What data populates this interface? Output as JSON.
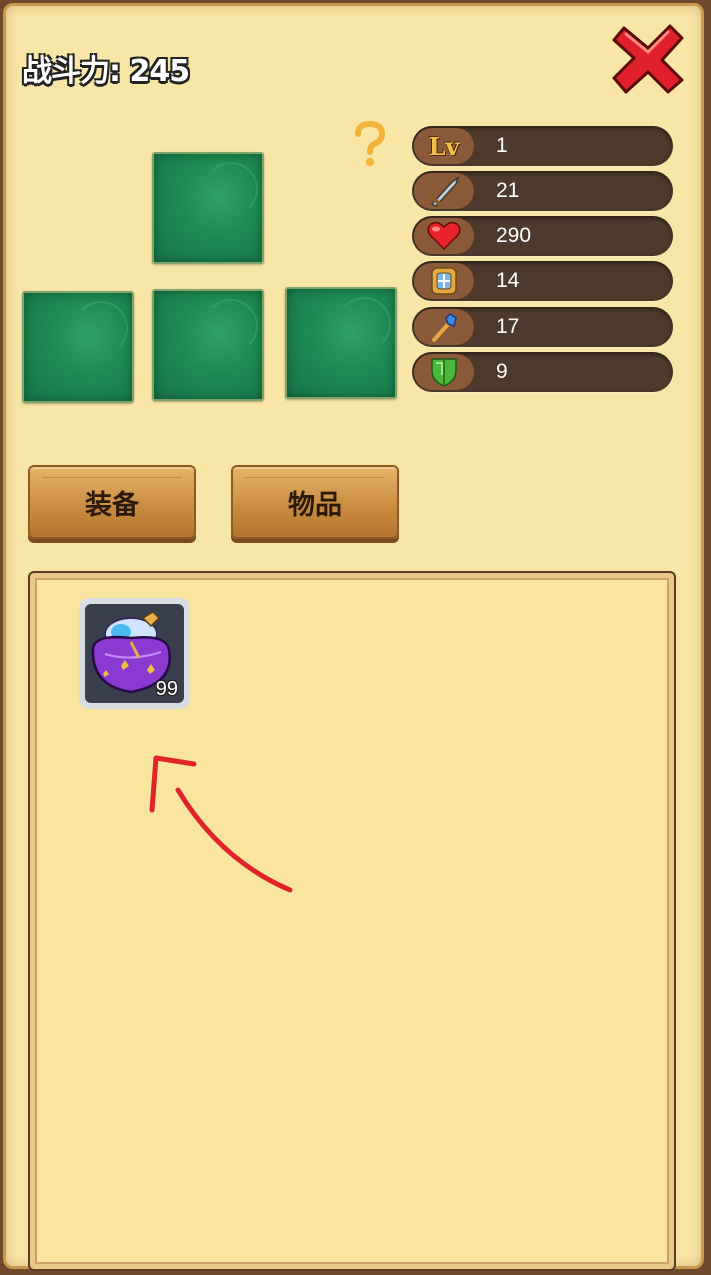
{
  "header": {
    "power_label": "战斗力: 245"
  },
  "stats": [
    {
      "icon": "level-icon",
      "value": "1"
    },
    {
      "icon": "sword-icon",
      "value": "21"
    },
    {
      "icon": "heart-icon",
      "value": "290"
    },
    {
      "icon": "shield-emblem-icon",
      "value": "14"
    },
    {
      "icon": "magic-staff-icon",
      "value": "17"
    },
    {
      "icon": "green-shield-icon",
      "value": "9"
    }
  ],
  "stat_icon_labels": {
    "level": "Lv"
  },
  "tabs": {
    "equipment": "装备",
    "items": "物品"
  },
  "inventory": {
    "items": [
      {
        "icon": "potion-bag-icon",
        "count": "99"
      }
    ]
  },
  "colors": {
    "panel_bg": "#f8e6a6",
    "slot_green": "#1e8a52",
    "stat_bg": "#4d3a2c",
    "close_red": "#e0202a",
    "annotation_red": "#e0242a"
  }
}
